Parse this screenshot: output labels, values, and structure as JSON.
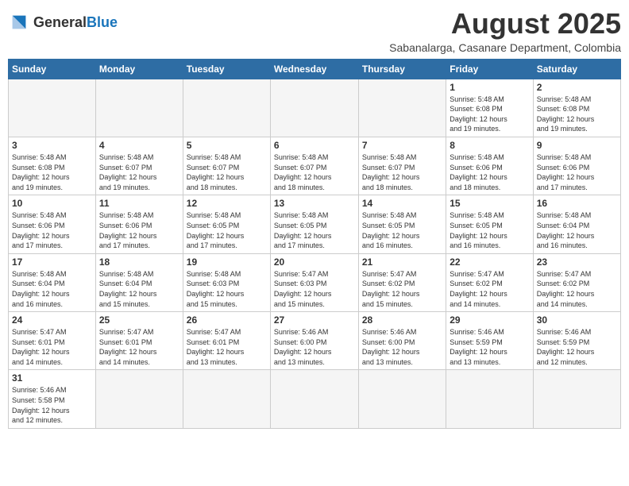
{
  "header": {
    "logo_general": "General",
    "logo_blue": "Blue",
    "month_title": "August 2025",
    "location": "Sabanalarga, Casanare Department, Colombia"
  },
  "days_of_week": [
    "Sunday",
    "Monday",
    "Tuesday",
    "Wednesday",
    "Thursday",
    "Friday",
    "Saturday"
  ],
  "weeks": [
    {
      "days": [
        {
          "number": "",
          "info": "",
          "empty": true
        },
        {
          "number": "",
          "info": "",
          "empty": true
        },
        {
          "number": "",
          "info": "",
          "empty": true
        },
        {
          "number": "",
          "info": "",
          "empty": true
        },
        {
          "number": "",
          "info": "",
          "empty": true
        },
        {
          "number": "1",
          "info": "Sunrise: 5:48 AM\nSunset: 6:08 PM\nDaylight: 12 hours\nand 19 minutes.",
          "empty": false
        },
        {
          "number": "2",
          "info": "Sunrise: 5:48 AM\nSunset: 6:08 PM\nDaylight: 12 hours\nand 19 minutes.",
          "empty": false
        }
      ]
    },
    {
      "days": [
        {
          "number": "3",
          "info": "Sunrise: 5:48 AM\nSunset: 6:08 PM\nDaylight: 12 hours\nand 19 minutes.",
          "empty": false
        },
        {
          "number": "4",
          "info": "Sunrise: 5:48 AM\nSunset: 6:07 PM\nDaylight: 12 hours\nand 19 minutes.",
          "empty": false
        },
        {
          "number": "5",
          "info": "Sunrise: 5:48 AM\nSunset: 6:07 PM\nDaylight: 12 hours\nand 18 minutes.",
          "empty": false
        },
        {
          "number": "6",
          "info": "Sunrise: 5:48 AM\nSunset: 6:07 PM\nDaylight: 12 hours\nand 18 minutes.",
          "empty": false
        },
        {
          "number": "7",
          "info": "Sunrise: 5:48 AM\nSunset: 6:07 PM\nDaylight: 12 hours\nand 18 minutes.",
          "empty": false
        },
        {
          "number": "8",
          "info": "Sunrise: 5:48 AM\nSunset: 6:06 PM\nDaylight: 12 hours\nand 18 minutes.",
          "empty": false
        },
        {
          "number": "9",
          "info": "Sunrise: 5:48 AM\nSunset: 6:06 PM\nDaylight: 12 hours\nand 17 minutes.",
          "empty": false
        }
      ]
    },
    {
      "days": [
        {
          "number": "10",
          "info": "Sunrise: 5:48 AM\nSunset: 6:06 PM\nDaylight: 12 hours\nand 17 minutes.",
          "empty": false
        },
        {
          "number": "11",
          "info": "Sunrise: 5:48 AM\nSunset: 6:06 PM\nDaylight: 12 hours\nand 17 minutes.",
          "empty": false
        },
        {
          "number": "12",
          "info": "Sunrise: 5:48 AM\nSunset: 6:05 PM\nDaylight: 12 hours\nand 17 minutes.",
          "empty": false
        },
        {
          "number": "13",
          "info": "Sunrise: 5:48 AM\nSunset: 6:05 PM\nDaylight: 12 hours\nand 17 minutes.",
          "empty": false
        },
        {
          "number": "14",
          "info": "Sunrise: 5:48 AM\nSunset: 6:05 PM\nDaylight: 12 hours\nand 16 minutes.",
          "empty": false
        },
        {
          "number": "15",
          "info": "Sunrise: 5:48 AM\nSunset: 6:05 PM\nDaylight: 12 hours\nand 16 minutes.",
          "empty": false
        },
        {
          "number": "16",
          "info": "Sunrise: 5:48 AM\nSunset: 6:04 PM\nDaylight: 12 hours\nand 16 minutes.",
          "empty": false
        }
      ]
    },
    {
      "days": [
        {
          "number": "17",
          "info": "Sunrise: 5:48 AM\nSunset: 6:04 PM\nDaylight: 12 hours\nand 16 minutes.",
          "empty": false
        },
        {
          "number": "18",
          "info": "Sunrise: 5:48 AM\nSunset: 6:04 PM\nDaylight: 12 hours\nand 15 minutes.",
          "empty": false
        },
        {
          "number": "19",
          "info": "Sunrise: 5:48 AM\nSunset: 6:03 PM\nDaylight: 12 hours\nand 15 minutes.",
          "empty": false
        },
        {
          "number": "20",
          "info": "Sunrise: 5:47 AM\nSunset: 6:03 PM\nDaylight: 12 hours\nand 15 minutes.",
          "empty": false
        },
        {
          "number": "21",
          "info": "Sunrise: 5:47 AM\nSunset: 6:02 PM\nDaylight: 12 hours\nand 15 minutes.",
          "empty": false
        },
        {
          "number": "22",
          "info": "Sunrise: 5:47 AM\nSunset: 6:02 PM\nDaylight: 12 hours\nand 14 minutes.",
          "empty": false
        },
        {
          "number": "23",
          "info": "Sunrise: 5:47 AM\nSunset: 6:02 PM\nDaylight: 12 hours\nand 14 minutes.",
          "empty": false
        }
      ]
    },
    {
      "days": [
        {
          "number": "24",
          "info": "Sunrise: 5:47 AM\nSunset: 6:01 PM\nDaylight: 12 hours\nand 14 minutes.",
          "empty": false
        },
        {
          "number": "25",
          "info": "Sunrise: 5:47 AM\nSunset: 6:01 PM\nDaylight: 12 hours\nand 14 minutes.",
          "empty": false
        },
        {
          "number": "26",
          "info": "Sunrise: 5:47 AM\nSunset: 6:01 PM\nDaylight: 12 hours\nand 13 minutes.",
          "empty": false
        },
        {
          "number": "27",
          "info": "Sunrise: 5:46 AM\nSunset: 6:00 PM\nDaylight: 12 hours\nand 13 minutes.",
          "empty": false
        },
        {
          "number": "28",
          "info": "Sunrise: 5:46 AM\nSunset: 6:00 PM\nDaylight: 12 hours\nand 13 minutes.",
          "empty": false
        },
        {
          "number": "29",
          "info": "Sunrise: 5:46 AM\nSunset: 5:59 PM\nDaylight: 12 hours\nand 13 minutes.",
          "empty": false
        },
        {
          "number": "30",
          "info": "Sunrise: 5:46 AM\nSunset: 5:59 PM\nDaylight: 12 hours\nand 12 minutes.",
          "empty": false
        }
      ]
    },
    {
      "days": [
        {
          "number": "31",
          "info": "Sunrise: 5:46 AM\nSunset: 5:58 PM\nDaylight: 12 hours\nand 12 minutes.",
          "empty": false
        },
        {
          "number": "",
          "info": "",
          "empty": true
        },
        {
          "number": "",
          "info": "",
          "empty": true
        },
        {
          "number": "",
          "info": "",
          "empty": true
        },
        {
          "number": "",
          "info": "",
          "empty": true
        },
        {
          "number": "",
          "info": "",
          "empty": true
        },
        {
          "number": "",
          "info": "",
          "empty": true
        }
      ]
    }
  ]
}
